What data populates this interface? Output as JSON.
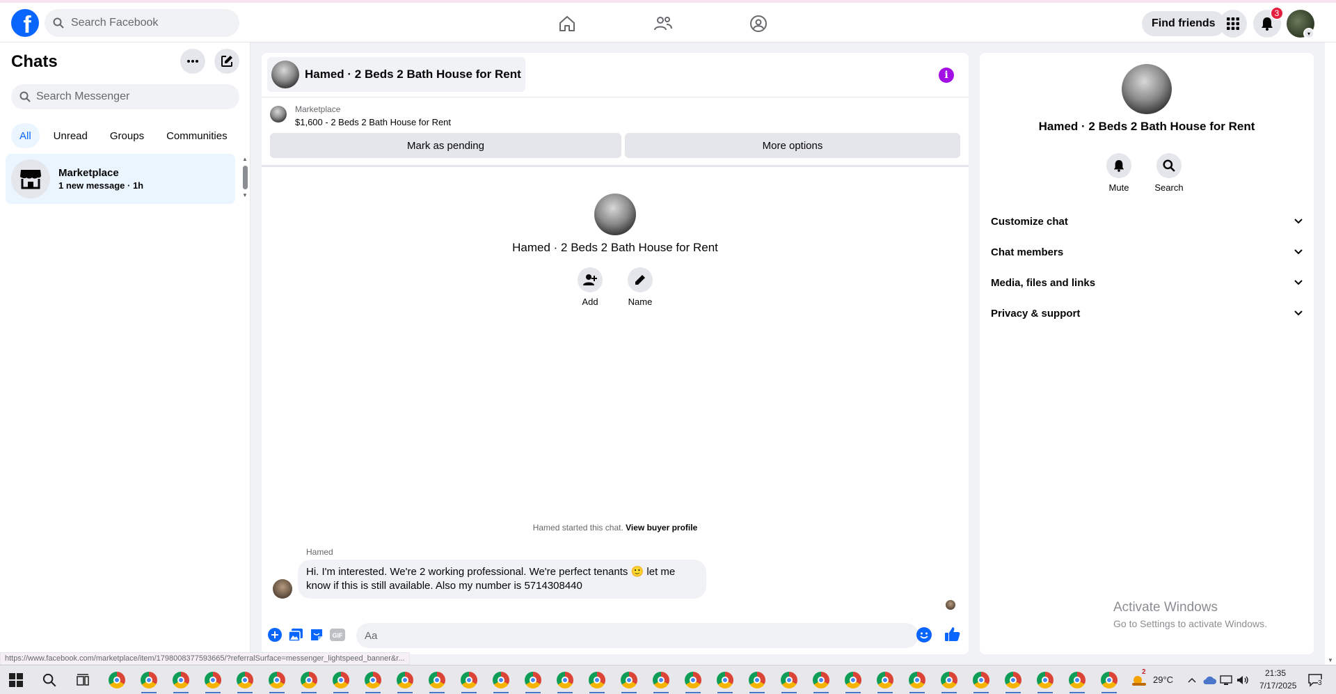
{
  "topnav": {
    "search_placeholder": "Search Facebook",
    "find_friends": "Find friends",
    "notification_count": "3"
  },
  "sidebar": {
    "title": "Chats",
    "search_placeholder": "Search Messenger",
    "filters": [
      "All",
      "Unread",
      "Groups",
      "Communities"
    ],
    "active_filter": "All",
    "chats": [
      {
        "name": "Marketplace",
        "subtitle": "1 new message · 1h"
      }
    ]
  },
  "chat": {
    "header_title": "Hamed · 2 Beds 2 Bath House for Rent",
    "marketplace_label": "Marketplace",
    "listing_line": "$1,600 - 2 Beds 2 Bath House for Rent",
    "mark_pending": "Mark as pending",
    "more_options": "More options",
    "intro_title": "Hamed · 2 Beds 2 Bath House for Rent",
    "intro_actions": [
      "Add",
      "Name"
    ],
    "started_text": "Hamed started this chat.",
    "view_buyer_profile": "View buyer profile",
    "messages": [
      {
        "sender": "Hamed",
        "text_line1": "Hi. I'm interested. We're 2 working professional. We're perfect tenants 🙂 let me",
        "text_line2": "know if this is still available. Also my number is 5714308440"
      }
    ],
    "composer_placeholder": "Aa"
  },
  "info_panel": {
    "title": "Hamed · 2 Beds 2 Bath House for Rent",
    "actions": [
      "Mute",
      "Search"
    ],
    "sections": [
      "Customize chat",
      "Chat members",
      "Media, files and links",
      "Privacy & support"
    ],
    "activate_line1": "Activate Windows",
    "activate_line2": "Go to Settings to activate Windows."
  },
  "status_url": "https://www.facebook.com/marketplace/item/1798008377593665/?referralSurface=messenger_lightspeed_banner&r...",
  "taskbar": {
    "weather_badge": "2",
    "temperature": "29°C",
    "time": "21:35",
    "date": "7/17/2025",
    "notification_count": "3"
  },
  "colors": {
    "facebook_blue": "#0866ff",
    "info_purple": "#a210e4",
    "badge_red": "#e41e3f",
    "selected_chat_bg": "#ebf5ff"
  }
}
